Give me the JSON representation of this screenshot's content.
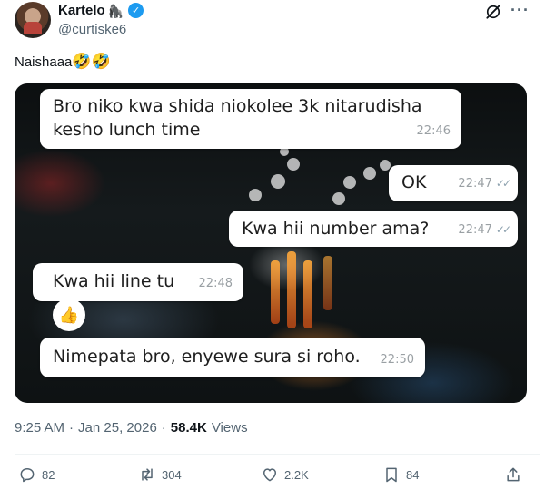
{
  "author": {
    "display_name": "Kartelo",
    "name_emoji": "🦍",
    "verified_mark": "✓",
    "handle": "@curtiske6"
  },
  "header_icons": [
    "grok-icon",
    "more-icon"
  ],
  "more_glyph": "···",
  "tweet": {
    "text": "Naishaaa",
    "emoji": "🤣🤣"
  },
  "media": {
    "messages": [
      {
        "side": "in",
        "text_line1": "Bro niko kwa shida niokolee 3k nitarudisha",
        "text_line2": "kesho lunch time",
        "time": "22:46"
      },
      {
        "side": "out",
        "text": "OK",
        "time": "22:47",
        "ticks": "✓✓"
      },
      {
        "side": "out",
        "text": "Kwa hii number ama?",
        "time": "22:47",
        "ticks": "✓✓"
      },
      {
        "side": "in",
        "text": "Kwa hii line tu",
        "time": "22:48"
      },
      {
        "side": "in",
        "text": "Nimepata bro, enyewe sura si roho.",
        "time": "22:50"
      }
    ],
    "reaction_emoji": "👍"
  },
  "meta": {
    "time": "9:25 AM",
    "separator": "·",
    "date": "Jan 25, 2026",
    "views_count": "58.4K",
    "views_label": "Views"
  },
  "actions": {
    "replies": "82",
    "reposts": "304",
    "likes": "2.2K",
    "bookmarks": "84"
  },
  "colors": {
    "accent": "#1d9bf0",
    "muted_text": "#536471",
    "text": "#0f1419"
  }
}
